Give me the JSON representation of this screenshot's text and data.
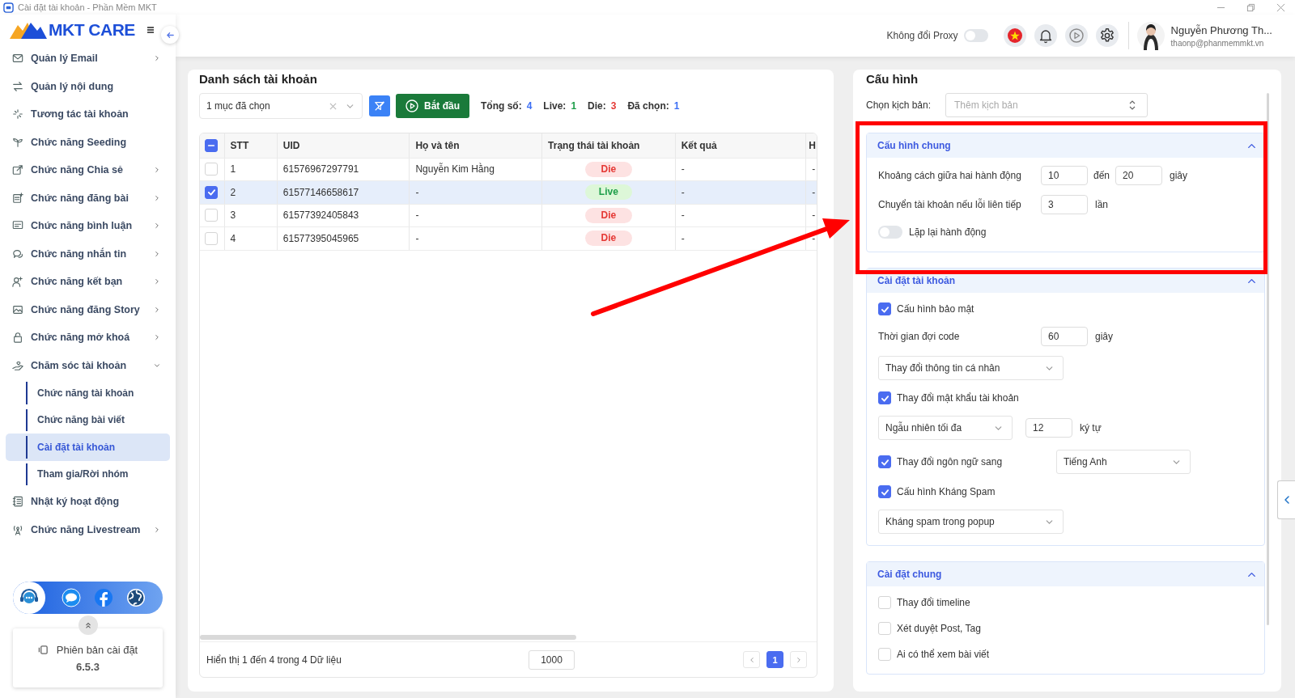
{
  "window": {
    "title": "Cài đặt tài khoản - Phần Mềm MKT"
  },
  "sidebar": {
    "logo": "MKT CARE",
    "items": [
      {
        "label": "Quản lý Email",
        "expandable": true,
        "expanded": false
      },
      {
        "label": "Quản lý nội dung",
        "expandable": false,
        "expanded": false
      },
      {
        "label": "Tương tác tài khoản",
        "expandable": false,
        "expanded": false
      },
      {
        "label": "Chức năng Seeding",
        "expandable": false,
        "expanded": false
      },
      {
        "label": "Chức năng Chia sẻ",
        "expandable": true,
        "expanded": false
      },
      {
        "label": "Chức năng đăng bài",
        "expandable": true,
        "expanded": false
      },
      {
        "label": "Chức năng bình luận",
        "expandable": true,
        "expanded": false
      },
      {
        "label": "Chức năng nhắn tin",
        "expandable": true,
        "expanded": false
      },
      {
        "label": "Chức năng kết bạn",
        "expandable": true,
        "expanded": false
      },
      {
        "label": "Chức năng đăng Story",
        "expandable": true,
        "expanded": false
      },
      {
        "label": "Chức năng mở khoá",
        "expandable": true,
        "expanded": false
      },
      {
        "label": "Chăm sóc tài khoản",
        "expandable": true,
        "expanded": true,
        "children": [
          {
            "label": "Chức năng tài khoản",
            "selected": false
          },
          {
            "label": "Chức năng bài viết",
            "selected": false
          },
          {
            "label": "Cài đặt tài khoản",
            "selected": true
          },
          {
            "label": "Tham gia/Rời nhóm",
            "selected": false
          }
        ]
      },
      {
        "label": "Nhật ký hoạt động",
        "expandable": false,
        "expanded": false
      },
      {
        "label": "Chức năng Livestream",
        "expandable": true,
        "expanded": false
      }
    ],
    "version": {
      "label": "Phiên bản cài đặt",
      "value": "6.5.3"
    }
  },
  "header": {
    "proxy": {
      "label": "Không đổi Proxy",
      "on": false
    },
    "user": {
      "name": "Nguyễn Phương Th...",
      "email": "thaonp@phanmemmkt.vn"
    }
  },
  "accounts": {
    "title": "Danh sách tài khoản",
    "selection": "1 mục đã chọn",
    "start_button": "Bắt đầu",
    "stats": [
      {
        "label": "Tổng số:",
        "value": "4",
        "color": "#3b6ef5"
      },
      {
        "label": "Live:",
        "value": "1",
        "color": "#1e9e4a"
      },
      {
        "label": "Die:",
        "value": "3",
        "color": "#e53935"
      },
      {
        "label": "Đã chọn:",
        "value": "1",
        "color": "#3b6ef5"
      }
    ],
    "table": {
      "header_indeterminate": true,
      "columns": [
        "STT",
        "UID",
        "Họ và tên",
        "Trạng thái tài khoản",
        "Kết quả",
        "H"
      ],
      "rows": [
        {
          "selected": false,
          "stt": "1",
          "uid": "61576967297791",
          "name": "Nguyễn Kim Hằng",
          "status": {
            "text": "Die",
            "kind": "die"
          },
          "result": "-",
          "column_6": "-"
        },
        {
          "selected": true,
          "stt": "2",
          "uid": "61577146658617",
          "name": "-",
          "status": {
            "text": "Live",
            "kind": "live"
          },
          "result": "-",
          "column_6": "-"
        },
        {
          "selected": false,
          "stt": "3",
          "uid": "61577392405843",
          "name": "-",
          "status": {
            "text": "Die",
            "kind": "die"
          },
          "result": "-",
          "column_6": "-"
        },
        {
          "selected": false,
          "stt": "4",
          "uid": "61577395045965",
          "name": "-",
          "status": {
            "text": "Die",
            "kind": "die"
          },
          "result": "-",
          "column_6": "-"
        }
      ]
    },
    "footer": {
      "summary": "Hiển thị 1 đến 4 trong 4 Dữ liệu",
      "page_size": "1000",
      "pages": [
        {
          "label": "1",
          "selected": true
        }
      ]
    }
  },
  "config": {
    "title": "Cấu hình",
    "script": {
      "label": "Chọn kịch bản:",
      "placeholder": "Thêm kịch bản"
    },
    "sections": [
      {
        "title": "Cấu hình chung",
        "expanded": true,
        "rows": [
          {
            "kind": "range",
            "label": "Khoảng cách giữa hai hành động",
            "from": "10",
            "separator": "đến",
            "to": "20",
            "unit": "giây"
          },
          {
            "kind": "number",
            "label": "Chuyển tài khoản nếu lỗi liên tiếp",
            "value": "3",
            "unit": "lần"
          },
          {
            "kind": "toggle",
            "label": "Lặp lại hành động",
            "on": false
          }
        ]
      },
      {
        "title": "Cài đặt tài khoản",
        "expanded": true,
        "rows": [
          {
            "kind": "checkbox",
            "label": "Cấu hình bảo mật",
            "checked": true
          },
          {
            "kind": "number",
            "label": "Thời gian đợi code",
            "value": "60",
            "unit": "giây"
          },
          {
            "kind": "select",
            "value": "Thay đổi thông tin cá nhân"
          },
          {
            "kind": "checkbox",
            "label": "Thay đổi mật khẩu tài khoản",
            "checked": true
          },
          {
            "kind": "select_number",
            "select": "Ngẫu nhiên tối đa",
            "value": "12",
            "unit": "ký tự"
          },
          {
            "kind": "checkbox_select",
            "label": "Thay đổi ngôn ngữ sang",
            "checked": true,
            "select": "Tiếng Anh"
          },
          {
            "kind": "checkbox",
            "label": "Cấu hình Kháng Spam",
            "checked": true
          },
          {
            "kind": "select",
            "value": "Kháng spam trong popup"
          }
        ]
      },
      {
        "title": "Cài đặt chung",
        "expanded": true,
        "rows": [
          {
            "kind": "checkbox",
            "label": "Thay đổi timeline",
            "checked": false
          },
          {
            "kind": "checkbox",
            "label": "Xét duyệt Post, Tag",
            "checked": false
          },
          {
            "kind": "checkbox",
            "label": "Ai có thể xem bài viết",
            "checked": false
          }
        ]
      }
    ]
  }
}
